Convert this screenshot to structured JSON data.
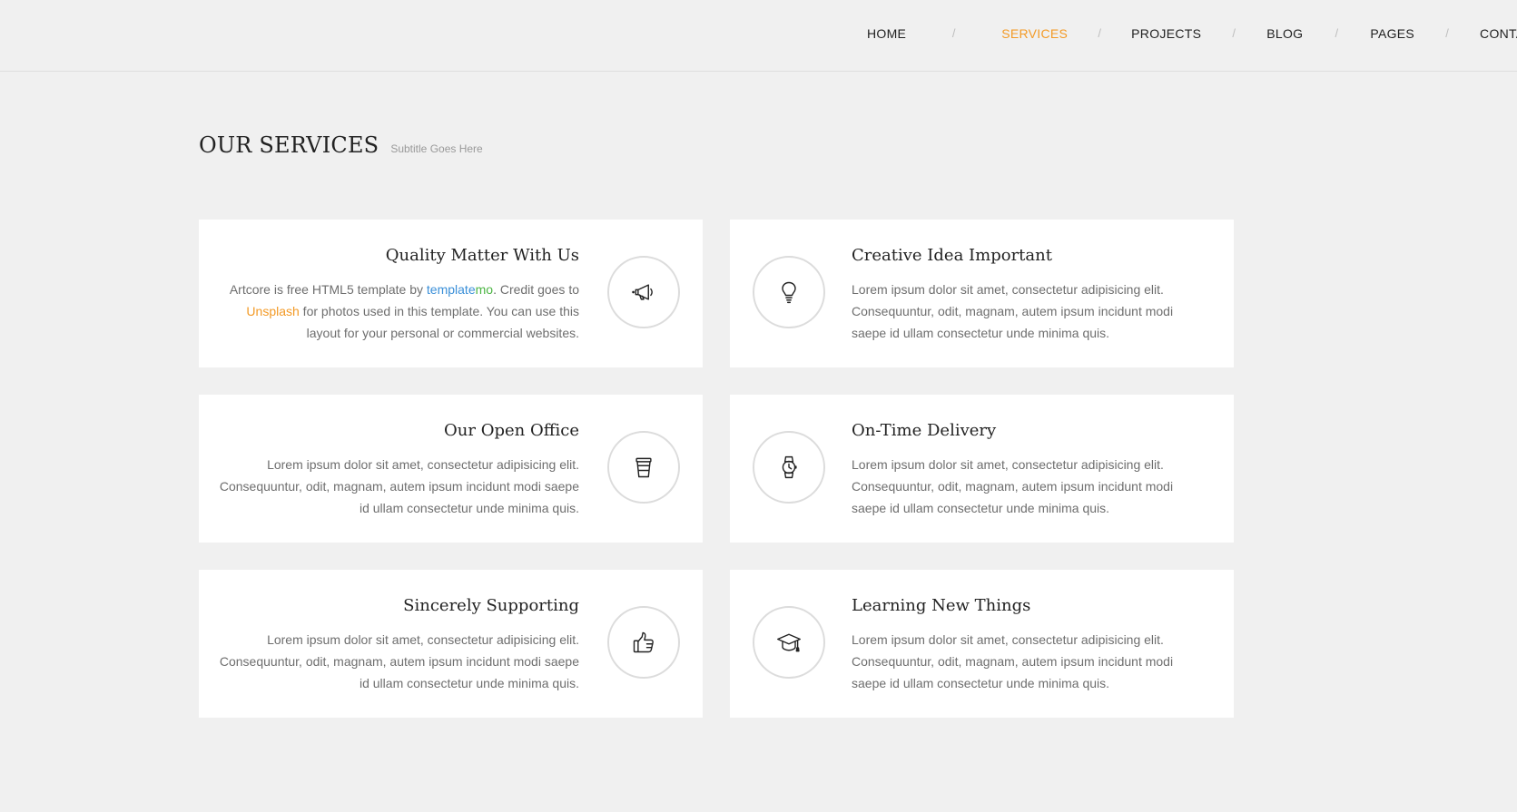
{
  "nav": {
    "items": [
      {
        "label": "HOME",
        "active": false
      },
      {
        "label": "SERVICES",
        "active": true
      },
      {
        "label": "PROJECTS",
        "active": false
      },
      {
        "label": "BLOG",
        "active": false
      },
      {
        "label": "PAGES",
        "active": false
      },
      {
        "label": "CONTACT",
        "active": false
      }
    ],
    "separator": "/"
  },
  "section": {
    "title": "OUR SERVICES",
    "subtitle": "Subtitle Goes Here"
  },
  "cards": [
    {
      "title": "Quality Matter With Us",
      "icon": "megaphone-icon",
      "text_before": "Artcore is free HTML5 template by ",
      "link1_part1": "template",
      "link1_part2": "mo",
      "text_middle": ". Credit goes to ",
      "link2": "Unsplash",
      "text_after": " for photos used in this template. You can use this layout for your personal or commercial websites."
    },
    {
      "title": "Creative Idea Important",
      "icon": "lightbulb-icon",
      "text": "Lorem ipsum dolor sit amet, consectetur adipisicing elit. Consequuntur, odit, magnam, autem ipsum incidunt modi saepe id ullam consectetur unde minima quis."
    },
    {
      "title": "Our Open Office",
      "icon": "coffee-cup-icon",
      "text": "Lorem ipsum dolor sit amet, consectetur adipisicing elit. Consequuntur, odit, magnam, autem ipsum incidunt modi saepe id ullam consectetur unde minima quis."
    },
    {
      "title": "On-Time Delivery",
      "icon": "wristwatch-icon",
      "text": "Lorem ipsum dolor sit amet, consectetur adipisicing elit. Consequuntur, odit, magnam, autem ipsum incidunt modi saepe id ullam consectetur unde minima quis."
    },
    {
      "title": "Sincerely Supporting",
      "icon": "thumbs-up-icon",
      "text": "Lorem ipsum dolor sit amet, consectetur adipisicing elit. Consequuntur, odit, magnam, autem ipsum incidunt modi saepe id ullam consectetur unde minima quis."
    },
    {
      "title": "Learning New Things",
      "icon": "graduation-cap-icon",
      "text": "Lorem ipsum dolor sit amet, consectetur adipisicing elit. Consequuntur, odit, magnam, autem ipsum incidunt modi saepe id ullam consectetur unde minima quis."
    }
  ],
  "colors": {
    "accent": "#f39a26",
    "link_blue": "#3a8fd8",
    "link_green": "#4bb543",
    "background": "#f0f0f0",
    "card": "#ffffff"
  }
}
